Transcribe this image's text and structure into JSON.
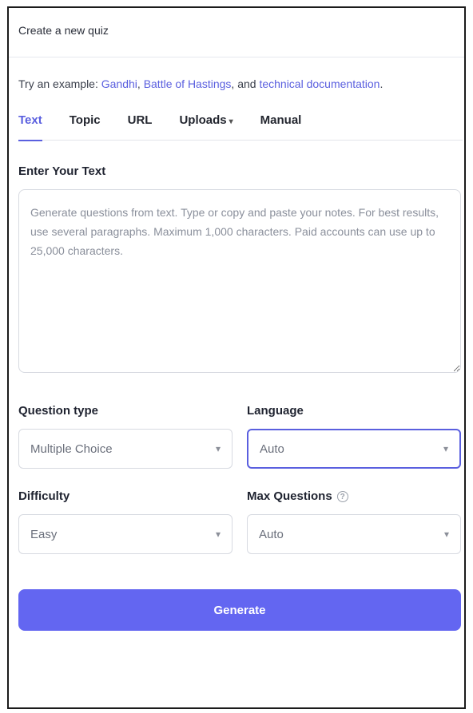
{
  "header": {
    "title": "Create a new quiz"
  },
  "example": {
    "prefix": "Try an example: ",
    "links": [
      "Gandhi",
      "Battle of Hastings",
      "technical documentation"
    ],
    "sep1": ", ",
    "sep2": ", and ",
    "suffix": "."
  },
  "tabs": [
    {
      "label": "Text",
      "active": true
    },
    {
      "label": "Topic",
      "active": false
    },
    {
      "label": "URL",
      "active": false
    },
    {
      "label": "Uploads",
      "active": false
    },
    {
      "label": "Manual",
      "active": false
    }
  ],
  "text_input": {
    "label": "Enter Your Text",
    "placeholder": "Generate questions from text. Type or copy and paste your notes. For best results, use several paragraphs. Maximum 1,000 characters. Paid accounts can use up to 25,000 characters."
  },
  "question_type": {
    "label": "Question type",
    "value": "Multiple Choice"
  },
  "language": {
    "label": "Language",
    "value": "Auto"
  },
  "difficulty": {
    "label": "Difficulty",
    "value": "Easy"
  },
  "max_questions": {
    "label": "Max Questions",
    "value": "Auto"
  },
  "generate_button": {
    "label": "Generate"
  },
  "colors": {
    "accent": "#5a5fdf",
    "button": "#6366f1"
  },
  "icons": {
    "dropdown": "chevron-down-icon",
    "help": "help-circle-icon"
  }
}
